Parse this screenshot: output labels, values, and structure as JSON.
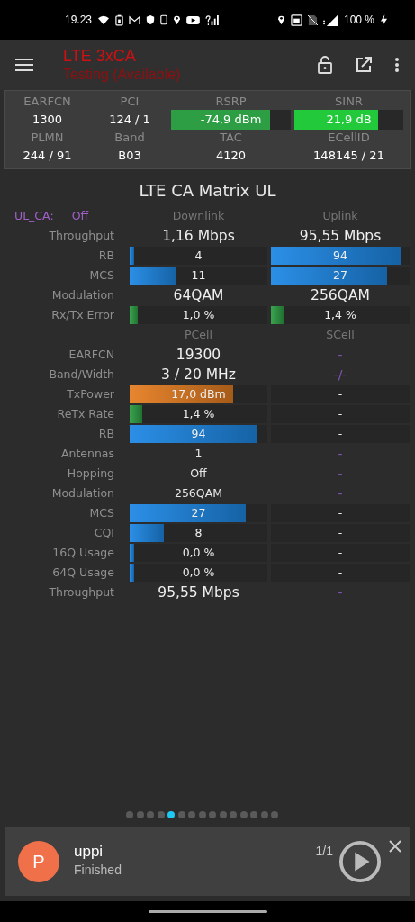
{
  "status_bar": {
    "time": "19.23",
    "battery": "100 %"
  },
  "app_bar": {
    "title": "LTE 3xCA",
    "subtitle": "Testing (Available)"
  },
  "cell_info": {
    "items": [
      {
        "label": "EARFCN",
        "value": "1300",
        "kind": "text"
      },
      {
        "label": "PCI",
        "value": "124 / 1",
        "kind": "text"
      },
      {
        "label": "RSRP",
        "value": "-74,9 dBm",
        "kind": "bar",
        "level": 0.83,
        "color": "#2e9e44"
      },
      {
        "label": "SINR",
        "value": "21,9 dB",
        "kind": "bar",
        "level": 0.77,
        "color": "#22c93a"
      },
      {
        "label": "PLMN",
        "value": "244 / 91",
        "kind": "text"
      },
      {
        "label": "Band",
        "value": "B03",
        "kind": "text"
      },
      {
        "label": "TAC",
        "value": "4120",
        "kind": "text"
      },
      {
        "label": "ECellID",
        "value": "148145 / 21",
        "kind": "text"
      }
    ]
  },
  "matrix": {
    "title": "LTE CA Matrix UL",
    "sections": [
      {
        "ul_ca": {
          "label": "UL_CA:",
          "value": "Off"
        },
        "headers": [
          "Downlink",
          "Uplink"
        ],
        "rows": [
          {
            "label": "Throughput",
            "cells": [
              {
                "kind": "big",
                "text": "1,16 Mbps"
              },
              {
                "kind": "big",
                "text": "95,55 Mbps"
              }
            ]
          },
          {
            "label": "RB",
            "cells": [
              {
                "kind": "bar",
                "text": "4",
                "level": 0.03,
                "color": "#1e88e5"
              },
              {
                "kind": "bar",
                "text": "94",
                "level": 0.94,
                "color": "#1e88e5"
              }
            ]
          },
          {
            "label": "MCS",
            "cells": [
              {
                "kind": "bar",
                "text": "11",
                "level": 0.34,
                "color": "#1e88e5"
              },
              {
                "kind": "bar",
                "text": "27",
                "level": 0.84,
                "color": "#1e88e5"
              }
            ]
          },
          {
            "label": "Modulation",
            "cells": [
              {
                "kind": "big",
                "text": "64QAM"
              },
              {
                "kind": "big",
                "text": "256QAM"
              }
            ]
          },
          {
            "label": "Rx/Tx Error",
            "cells": [
              {
                "kind": "bar",
                "text": "1,0 %",
                "level": 0.06,
                "color": "#2e9e44"
              },
              {
                "kind": "bar",
                "text": "1,4 %",
                "level": 0.09,
                "color": "#2e9e44"
              }
            ]
          }
        ]
      },
      {
        "headers": [
          "PCell",
          "SCell"
        ],
        "rows": [
          {
            "label": "EARFCN",
            "cells": [
              {
                "kind": "big",
                "text": "19300"
              },
              {
                "kind": "muted",
                "text": "-"
              }
            ]
          },
          {
            "label": "Band/Width",
            "cells": [
              {
                "kind": "big",
                "text": "3 / 20 MHz"
              },
              {
                "kind": "muted",
                "text": "-/-"
              }
            ]
          },
          {
            "label": "TxPower",
            "cells": [
              {
                "kind": "bar",
                "text": "17,0 dBm",
                "level": 0.75,
                "color": "#e67e22"
              },
              {
                "kind": "track",
                "text": "-"
              }
            ]
          },
          {
            "label": "ReTx Rate",
            "cells": [
              {
                "kind": "bar",
                "text": "1,4 %",
                "level": 0.09,
                "color": "#2e9e44"
              },
              {
                "kind": "track",
                "text": "-"
              }
            ]
          },
          {
            "label": "RB",
            "cells": [
              {
                "kind": "bar",
                "text": "94",
                "level": 0.93,
                "color": "#1e88e5"
              },
              {
                "kind": "track",
                "text": "-"
              }
            ]
          },
          {
            "label": "Antennas",
            "cells": [
              {
                "kind": "text",
                "text": "1"
              },
              {
                "kind": "muted",
                "text": "-"
              }
            ]
          },
          {
            "label": "Hopping",
            "cells": [
              {
                "kind": "text",
                "text": "Off"
              },
              {
                "kind": "muted",
                "text": "-"
              }
            ]
          },
          {
            "label": "Modulation",
            "cells": [
              {
                "kind": "text",
                "text": "256QAM"
              },
              {
                "kind": "muted",
                "text": "-"
              }
            ]
          },
          {
            "label": "MCS",
            "cells": [
              {
                "kind": "bar",
                "text": "27",
                "level": 0.84,
                "color": "#1e88e5"
              },
              {
                "kind": "track",
                "text": "-"
              }
            ]
          },
          {
            "label": "CQI",
            "cells": [
              {
                "kind": "bar",
                "text": "8",
                "level": 0.25,
                "color": "#1e88e5"
              },
              {
                "kind": "track",
                "text": "-"
              }
            ]
          },
          {
            "label": "16Q Usage",
            "cells": [
              {
                "kind": "bar",
                "text": "0,0 %",
                "level": 0.03,
                "color": "#1e88e5"
              },
              {
                "kind": "track",
                "text": "-"
              }
            ]
          },
          {
            "label": "64Q Usage",
            "cells": [
              {
                "kind": "bar",
                "text": "0,0 %",
                "level": 0.03,
                "color": "#1e88e5"
              },
              {
                "kind": "track",
                "text": "-"
              }
            ]
          },
          {
            "label": "Throughput",
            "cells": [
              {
                "kind": "big",
                "text": "95,55 Mbps"
              },
              {
                "kind": "muted",
                "text": "-"
              }
            ]
          }
        ]
      }
    ]
  },
  "pager": {
    "dots": [
      {
        "selected": false
      },
      {
        "selected": false
      },
      {
        "selected": false
      },
      {
        "selected": false
      },
      {
        "selected": true
      },
      {
        "selected": false
      },
      {
        "selected": false
      },
      {
        "selected": false
      },
      {
        "selected": false
      },
      {
        "selected": false
      },
      {
        "selected": false
      },
      {
        "selected": false
      },
      {
        "selected": false
      },
      {
        "selected": false
      },
      {
        "selected": false
      }
    ]
  },
  "notification": {
    "avatar": "P",
    "title": "uppi",
    "subtitle": "Finished",
    "count": "1/1"
  }
}
